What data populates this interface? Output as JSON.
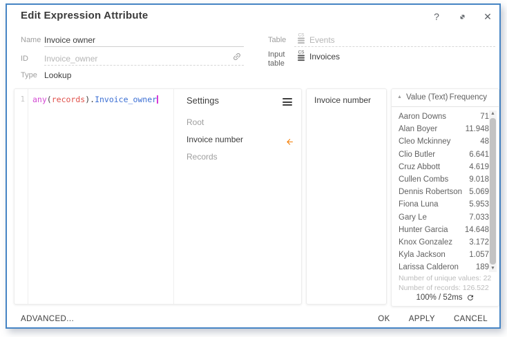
{
  "window": {
    "title": "Edit Expression Attribute",
    "icons": {
      "help": "?",
      "expand": "expand-diagonal",
      "close": "✕"
    }
  },
  "form": {
    "name": {
      "label": "Name",
      "value": "Invoice owner"
    },
    "id": {
      "label": "ID",
      "value": "Invoice_owner",
      "icon": "link-icon"
    },
    "type": {
      "label": "Type",
      "value": "Lookup"
    },
    "table": {
      "label": "Table",
      "value": "Events",
      "icon": "cs-table-icon"
    },
    "input_table": {
      "label": "Input table",
      "value": "Invoices",
      "icon": "cs-table-icon"
    }
  },
  "editor": {
    "line_number": "1",
    "code": {
      "fn": "any",
      "open": "(",
      "arg": "records",
      "close": ")",
      "dot": ".",
      "prop": "Invoice_owner"
    }
  },
  "settings": {
    "title": "Settings",
    "menu_icon": "hamburger-icon",
    "items": [
      {
        "label": "Root",
        "active": false
      },
      {
        "label": "Invoice number",
        "active": true
      },
      {
        "label": "Records",
        "active": false
      }
    ]
  },
  "preview": {
    "title": "Invoice number"
  },
  "values_panel": {
    "sort_icon": "sort-ascending-icon",
    "columns": {
      "value": "Value (Text)",
      "frequency": "Frequency"
    },
    "rows": [
      {
        "value": "Aaron Downs",
        "frequency": "71"
      },
      {
        "value": "Alan Boyer",
        "frequency": "11.948"
      },
      {
        "value": "Cleo Mckinney",
        "frequency": "48"
      },
      {
        "value": "Clio Butler",
        "frequency": "6.641"
      },
      {
        "value": "Cruz Abbott",
        "frequency": "4.619"
      },
      {
        "value": "Cullen Combs",
        "frequency": "9.018"
      },
      {
        "value": "Dennis Robertson",
        "frequency": "5.069"
      },
      {
        "value": "Fiona Luna",
        "frequency": "5.953"
      },
      {
        "value": "Gary Le",
        "frequency": "7.033"
      },
      {
        "value": "Hunter Garcia",
        "frequency": "14.648"
      },
      {
        "value": "Knox Gonzalez",
        "frequency": "3.172"
      },
      {
        "value": "Kyla Jackson",
        "frequency": "1.057"
      },
      {
        "value": "Larissa Calderon",
        "frequency": "189"
      }
    ],
    "unique_values": "Number of unique values: 22",
    "records": "Number of records: 126.522",
    "perf": "100% / 52ms",
    "refresh_icon": "refresh-icon"
  },
  "footer": {
    "advanced": "ADVANCED...",
    "ok": "OK",
    "apply": "APPLY",
    "cancel": "CANCEL"
  },
  "colors": {
    "dialog_border": "#4584c4",
    "accent_orange": "#f57c00",
    "code_fn": "#d34ad3",
    "code_arg": "#e0504a",
    "code_prop": "#3b6fd4",
    "caret": "#d63ad6"
  }
}
